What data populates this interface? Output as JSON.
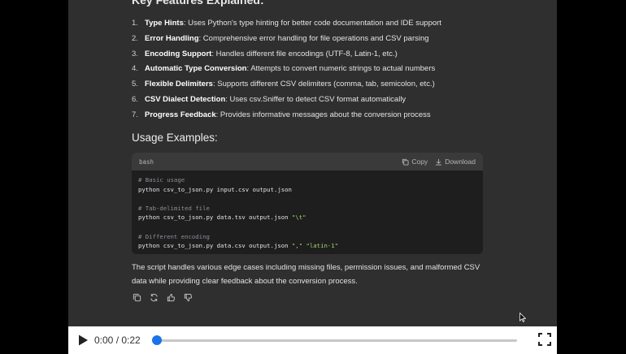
{
  "section_heading": "Key Features Explained:",
  "features": [
    {
      "num": "1.",
      "title": "Type Hints",
      "desc": ": Uses Python's type hinting for better code documentation and IDE support"
    },
    {
      "num": "2.",
      "title": "Error Handling",
      "desc": ": Comprehensive error handling for file operations and CSV parsing"
    },
    {
      "num": "3.",
      "title": "Encoding Support",
      "desc": ": Handles different file encodings (UTF-8, Latin-1, etc.)"
    },
    {
      "num": "4.",
      "title": "Automatic Type Conversion",
      "desc": ": Attempts to convert numeric strings to actual numbers"
    },
    {
      "num": "5.",
      "title": "Flexible Delimiters",
      "desc": ": Supports different CSV delimiters (comma, tab, semicolon, etc.)"
    },
    {
      "num": "6.",
      "title": "CSV Dialect Detection",
      "desc": ": Uses csv.Sniffer to detect CSV format automatically"
    },
    {
      "num": "7.",
      "title": "Progress Feedback",
      "desc": ": Provides informative messages about the conversion process"
    }
  ],
  "usage_heading": "Usage Examples:",
  "code": {
    "language": "bash",
    "copy_label": "Copy",
    "download_label": "Download",
    "comment1": "# Basic usage",
    "cmd1": "python csv_to_json.py input.csv output.json",
    "comment2": "# Tab-delimited file",
    "cmd2": "python csv_to_json.py data.tsv output.json ",
    "cmd2_str": "\"\\t\"",
    "comment3": "# Different encoding",
    "cmd3": "python csv_to_json.py data.csv output.json ",
    "cmd3_str1": "\",\"",
    "cmd3_str2": "\"latin-1\""
  },
  "summary": "The script handles various edge cases including missing files, permission issues, and malformed CSV data while providing clear feedback about the conversion process.",
  "player": {
    "time": "0:00 / 0:22",
    "progress": 0.0
  },
  "colors": {
    "accent": "#1a73e8",
    "string": "#a8d46f",
    "comment": "#8a8f98"
  }
}
